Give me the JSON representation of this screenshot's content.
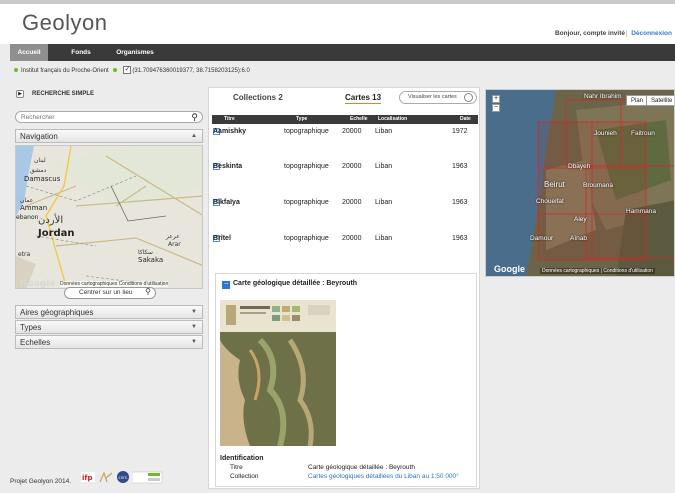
{
  "header": {
    "title": "Geolyon",
    "greeting": "Bonjour, compte invité",
    "logout": "Déconnexion"
  },
  "nav": {
    "tabs": [
      {
        "label": "Accueil",
        "active": true
      },
      {
        "label": "Fonds",
        "active": false
      },
      {
        "label": "Organismes",
        "active": false
      }
    ]
  },
  "breadcrumb": {
    "institution": "Institut français du Proche-Orient",
    "coords": "(31.709476360019377, 38.7158203125):6.0"
  },
  "search": {
    "title": "RECHERCHE SIMPLE",
    "placeholder": "Rechercher"
  },
  "panels": {
    "navigation": "Navigation",
    "aires": "Aires géographiques",
    "types": "Types",
    "echelles": "Echelles",
    "center_btn": "Centrer sur un lieu"
  },
  "small_map": {
    "attribution": "Données cartographiques  Conditions d'utilisation",
    "labels": [
      "Damascus",
      "دمشق",
      "Amman",
      "عمان",
      "Jordan",
      "الأردن",
      "Sakaka",
      "سكاكا",
      "ebanon",
      "Arar",
      "عرعر",
      "etra",
      "لبنان"
    ]
  },
  "collections": {
    "tab_collections": "Collections 2",
    "tab_cartes": "Cartes 13",
    "visualize_btn": "Visualiser les cartes",
    "columns": [
      "Titre",
      "Type",
      "Echelle",
      "Localisation",
      "Date"
    ],
    "rows": [
      {
        "title": "Aamishky",
        "type": "topographique",
        "scale": "20000",
        "location": "Liban",
        "date": "1972"
      },
      {
        "title": "Beskinta",
        "type": "topographique",
        "scale": "20000",
        "location": "Liban",
        "date": "1963"
      },
      {
        "title": "Bikfaïya",
        "type": "topographique",
        "scale": "20000",
        "location": "Liban",
        "date": "1963"
      },
      {
        "title": "Brîtel",
        "type": "topographique",
        "scale": "20000",
        "location": "Liban",
        "date": "1963"
      }
    ]
  },
  "detail": {
    "title": "Carte géologique détaillée : Beyrouth",
    "ident_label": "Identification",
    "fields": [
      {
        "label": "Titre",
        "value": "Carte géologique détaillée : Beyrouth"
      },
      {
        "label": "Collection",
        "value": "Cartes géologiques détaillées du Liban au 1:50 000°"
      }
    ]
  },
  "right_map": {
    "plan": "Plan",
    "satellite": "Satellite",
    "attribution": "Données cartographiques | Conditions d'utilisation",
    "cities": [
      "Jounieh",
      "Faitroun",
      "Dbayeh",
      "Beirut",
      "Broumana",
      "Choueifat",
      "Hammana",
      "Aley",
      "Damour",
      "Aïnab",
      "Nahr Ibrahim"
    ]
  },
  "footer": {
    "text": "Projet Geolyon 2014."
  },
  "colors": {
    "navbar": "#3a3a3a",
    "accent": "#e0861e",
    "link": "#2f74c0",
    "green_dot": "#6dbb2d"
  }
}
